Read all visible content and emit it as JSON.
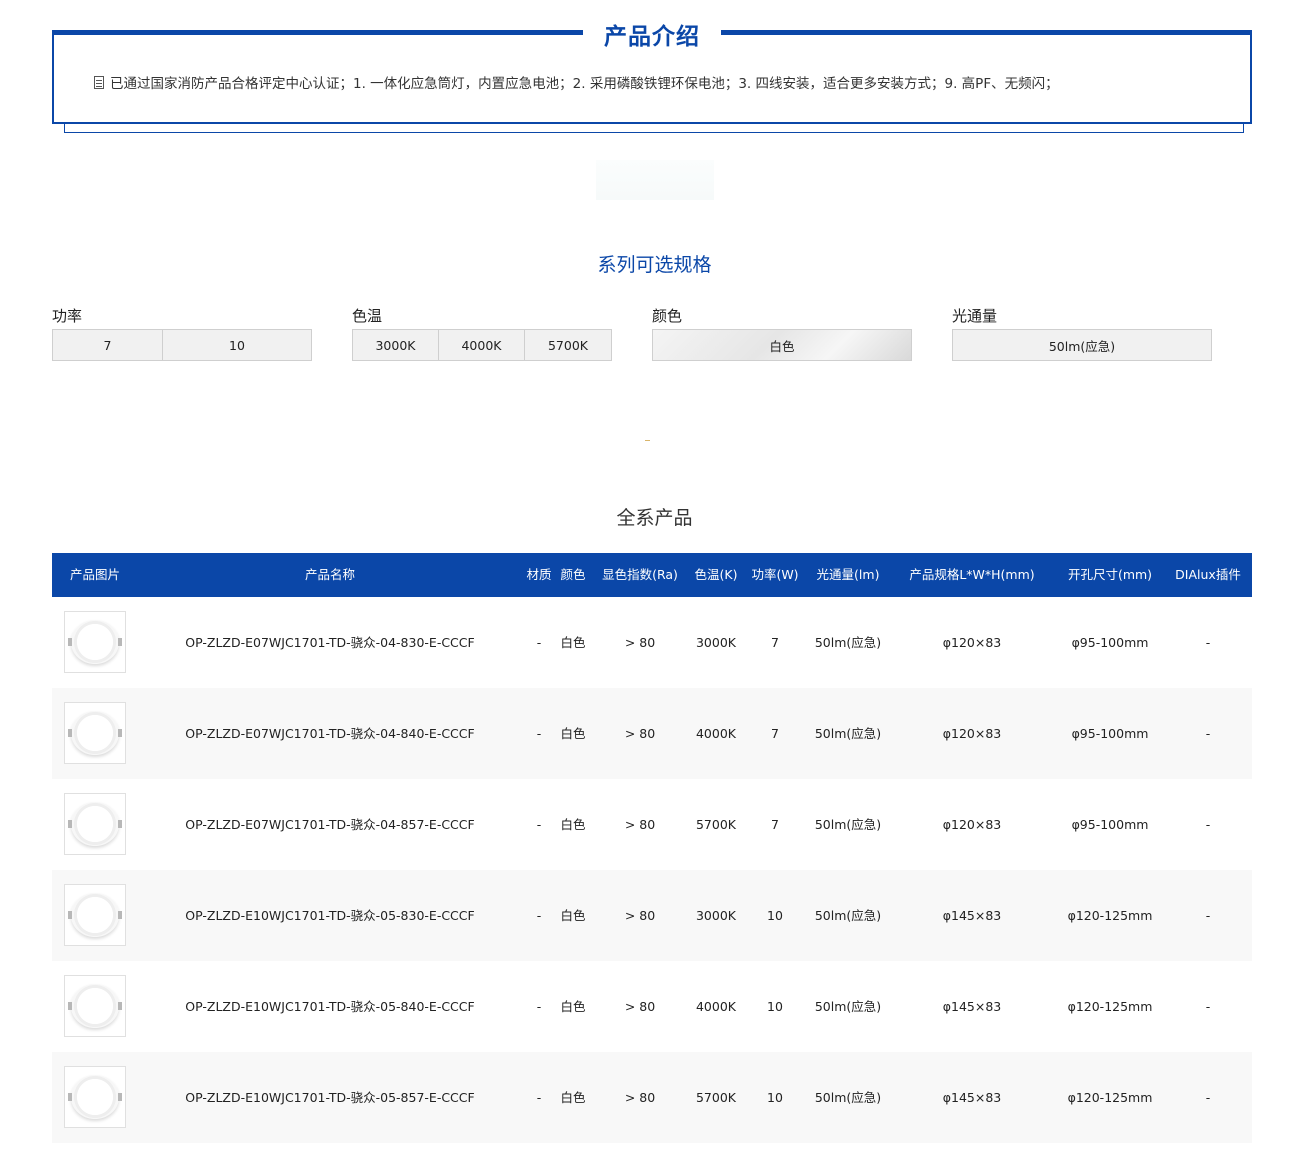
{
  "intro": {
    "title": "产品介绍",
    "text": "已通过国家消防产品合格评定中心认证；1. 一体化应急筒灯，内置应急电池；2. 采用磷酸铁锂环保电池；3. 四线安装，适合更多安装方式；9. 高PF、无频闪；"
  },
  "spec": {
    "title": "系列可选规格",
    "groups": [
      {
        "label": "功率",
        "options": [
          "7",
          "10"
        ]
      },
      {
        "label": "色温",
        "options": [
          "3000K",
          "4000K",
          "5700K"
        ]
      },
      {
        "label": "颜色",
        "options": [
          "白色"
        ],
        "active": 0
      },
      {
        "label": "光通量",
        "options": [
          "50lm(应急)"
        ]
      }
    ]
  },
  "products": {
    "title": "全系产品",
    "columns": [
      "产品图片",
      "产品名称",
      "材质",
      "颜色",
      "显色指数(Ra)",
      "色温(K)",
      "功率(W)",
      "光通量(lm)",
      "产品规格L*W*H(mm)",
      "开孔尺寸(mm)",
      "DIAlux插件"
    ],
    "rows": [
      {
        "name": "OP-ZLZD-E07WJC1701-TD-骁众-04-830-E-CCCF",
        "material": "-",
        "color": "白色",
        "ra": "> 80",
        "cct": "3000K",
        "power": "7",
        "flux": "50lm(应急)",
        "size": "φ120×83",
        "cutout": "φ95-100mm",
        "dialux": "-"
      },
      {
        "name": "OP-ZLZD-E07WJC1701-TD-骁众-04-840-E-CCCF",
        "material": "-",
        "color": "白色",
        "ra": "> 80",
        "cct": "4000K",
        "power": "7",
        "flux": "50lm(应急)",
        "size": "φ120×83",
        "cutout": "φ95-100mm",
        "dialux": "-"
      },
      {
        "name": "OP-ZLZD-E07WJC1701-TD-骁众-04-857-E-CCCF",
        "material": "-",
        "color": "白色",
        "ra": "> 80",
        "cct": "5700K",
        "power": "7",
        "flux": "50lm(应急)",
        "size": "φ120×83",
        "cutout": "φ95-100mm",
        "dialux": "-"
      },
      {
        "name": "OP-ZLZD-E10WJC1701-TD-骁众-05-830-E-CCCF",
        "material": "-",
        "color": "白色",
        "ra": "> 80",
        "cct": "3000K",
        "power": "10",
        "flux": "50lm(应急)",
        "size": "φ145×83",
        "cutout": "φ120-125mm",
        "dialux": "-"
      },
      {
        "name": "OP-ZLZD-E10WJC1701-TD-骁众-05-840-E-CCCF",
        "material": "-",
        "color": "白色",
        "ra": "> 80",
        "cct": "4000K",
        "power": "10",
        "flux": "50lm(应急)",
        "size": "φ145×83",
        "cutout": "φ120-125mm",
        "dialux": "-"
      },
      {
        "name": "OP-ZLZD-E10WJC1701-TD-骁众-05-857-E-CCCF",
        "material": "-",
        "color": "白色",
        "ra": "> 80",
        "cct": "5700K",
        "power": "10",
        "flux": "50lm(应急)",
        "size": "φ145×83",
        "cutout": "φ120-125mm",
        "dialux": "-"
      }
    ]
  },
  "colors": {
    "brand": "#0b47a8",
    "row_alt": "#f8f8f8"
  }
}
